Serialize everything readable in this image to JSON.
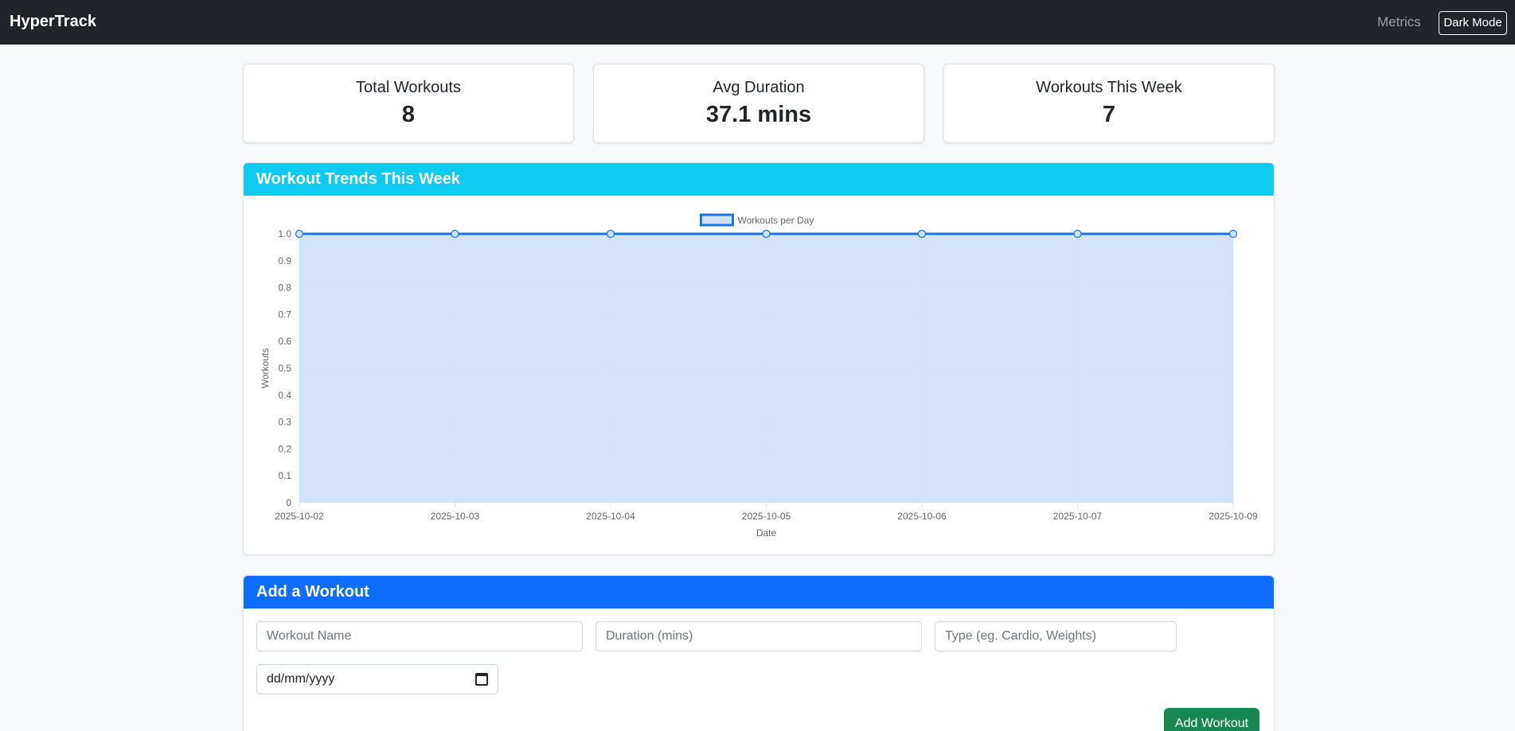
{
  "navbar": {
    "brand": "HyperTrack",
    "metrics_link": "Metrics",
    "dark_mode_label": "Dark Mode"
  },
  "stats": [
    {
      "title": "Total Workouts",
      "value": "8"
    },
    {
      "title": "Avg Duration",
      "value": "37.1 mins"
    },
    {
      "title": "Workouts This Week",
      "value": "7"
    }
  ],
  "trends": {
    "header": "Workout Trends This Week"
  },
  "chart_data": {
    "type": "area",
    "x": [
      "2025-10-02",
      "2025-10-03",
      "2025-10-04",
      "2025-10-05",
      "2025-10-06",
      "2025-10-07",
      "2025-10-09"
    ],
    "series": [
      {
        "name": "Workouts per Day",
        "values": [
          1,
          1,
          1,
          1,
          1,
          1,
          1
        ]
      }
    ],
    "xlabel": "Date",
    "ylabel": "Workouts",
    "ylim": [
      0,
      1.0
    ],
    "yticks": [
      "0",
      "0.1",
      "0.2",
      "0.3",
      "0.4",
      "0.5",
      "0.6",
      "0.7",
      "0.8",
      "0.9",
      "1.0"
    ],
    "grid": true,
    "legend": "top-center",
    "line_color": "#1a73e8",
    "fill_color": "#cfe0fc"
  },
  "add_workout": {
    "header": "Add a Workout",
    "name_placeholder": "Workout Name",
    "duration_placeholder": "Duration (mins)",
    "type_placeholder": "Type (eg. Cardio, Weights)",
    "date_placeholder": "dd/mm/yyyy",
    "submit_label": "Add Workout"
  }
}
